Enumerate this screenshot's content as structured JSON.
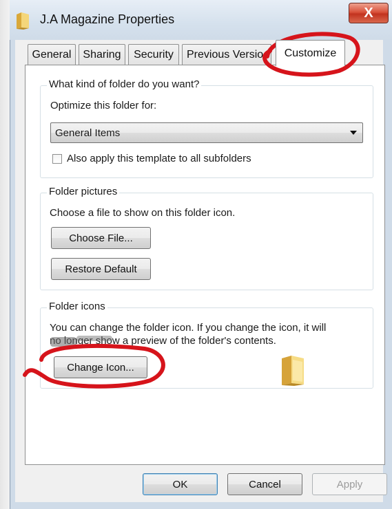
{
  "window": {
    "title": "J.A Magazine Properties",
    "close_label": "X"
  },
  "tabs": [
    {
      "label": "General"
    },
    {
      "label": "Sharing"
    },
    {
      "label": "Security"
    },
    {
      "label": "Previous Versio"
    },
    {
      "label": "Customize",
      "active": true
    }
  ],
  "folder_type": {
    "group_label": "What kind of folder do you want?",
    "optimize_label": "Optimize this folder for:",
    "selected_option": "General Items",
    "apply_subfolders_label": "Also apply this template to all subfolders",
    "apply_subfolders_checked": false
  },
  "folder_pictures": {
    "group_label": "Folder pictures",
    "description": "Choose a file to show on this folder icon.",
    "choose_file_label": "Choose File...",
    "restore_default_label": "Restore Default"
  },
  "folder_icons": {
    "group_label": "Folder icons",
    "description_line1": "You can change the folder icon. If you change the icon, it will",
    "description_line2": "no longer show a preview of the folder's contents.",
    "change_icon_label": "Change Icon..."
  },
  "footer": {
    "ok_label": "OK",
    "cancel_label": "Cancel",
    "apply_label": "Apply"
  },
  "colors": {
    "annotation_red": "#d6141b",
    "close_button": "#c9432b",
    "folder_yellow": "#f3d36a"
  }
}
